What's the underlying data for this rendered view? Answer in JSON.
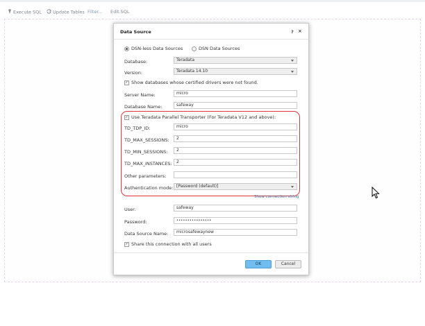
{
  "toolbar": {
    "execute_sql": "Execute SQL",
    "update_tables": "Update Tables",
    "filter": "Filter...",
    "edit_sql": "Edit SQL"
  },
  "dialog": {
    "title": "Data Source",
    "help": "?",
    "close": "×",
    "radio_dsnless": "DSN-less Data Sources",
    "radio_dsn": "DSN Data Sources",
    "database_label": "Database:",
    "database_value": "Teradata",
    "version_label": "Version:",
    "version_value": "Teradata 14.10",
    "show_uncertified_label": "Show databases whose certified drivers were not found.",
    "server_label": "Server Name:",
    "server_value": "micro",
    "dbname_label": "Database Name:",
    "dbname_value": "safeway",
    "tpt_label": "Use Teradata Parallel Transporter (For Teradata V12 and above):",
    "tdp_label": "TD_TDP_ID:",
    "tdp_value": "micro",
    "max_sessions_label": "TD_MAX_SESSIONS:",
    "max_sessions_value": "2",
    "min_sessions_label": "TD_MIN_SESSIONS:",
    "min_sessions_value": "2",
    "max_instances_label": "TD_MAX_INSTANCES:",
    "max_instances_value": "2",
    "other_params_label": "Other parameters:",
    "other_params_value": "",
    "auth_label": "Authentication mode:",
    "auth_value": "[Password (default)]",
    "show_conn_string": "Show connection string",
    "user_label": "User:",
    "user_value": "safeway",
    "password_label": "Password:",
    "password_value": "••••••••••••••••",
    "dsname_label": "Data Source Name:",
    "dsname_value": "microsafewaynew",
    "share_label": "Share this connection with all users",
    "ok": "OK",
    "cancel": "Cancel"
  },
  "icons": [
    "execute-icon",
    "update-icon",
    "help-icon",
    "close-icon",
    "chevron-down-icon",
    "mouse-cursor-icon"
  ]
}
